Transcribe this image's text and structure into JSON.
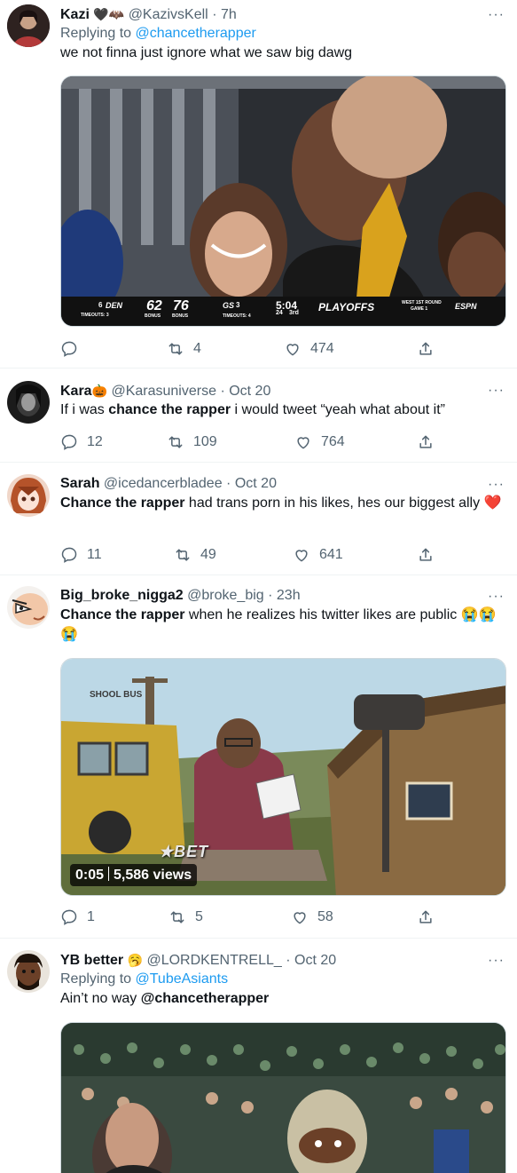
{
  "tweets": [
    {
      "name": "Kazi",
      "name_emoji": "🖤🦇",
      "handle": "@KazivsKell",
      "time": "7h",
      "replying_prefix": "Replying to",
      "replying_to": "@chancetherapper",
      "text": "we not finna just ignore what we saw big dawg",
      "scorebug": {
        "team1": "DEN",
        "seed1": "6",
        "score1": "62",
        "score2": "76",
        "team2": "GS",
        "seed2": "3",
        "timeouts1": "TIMEOUTS: 3",
        "bonus1": "BONUS",
        "bonus2": "BONUS",
        "timeouts2": "TIMEOUTS: 4",
        "clock": "5:04",
        "shot_clock": "24",
        "quarter": "3rd",
        "playoffs": "PLAYOFFS",
        "round": "WEST 1ST ROUND",
        "game": "GAME 1",
        "network": "ESPN"
      },
      "actions": {
        "reply": "",
        "retweet": "4",
        "like": "474"
      }
    },
    {
      "name": "Kara",
      "name_emoji": "🎃",
      "handle": "@Karasuniverse",
      "time": "Oct 20",
      "text_pre": "If i was ",
      "text_bold": "chance the rapper",
      "text_post": " i would tweet “yeah what about it”",
      "actions": {
        "reply": "12",
        "retweet": "109",
        "like": "764"
      }
    },
    {
      "name": "Sarah",
      "handle": "@icedancerbladee",
      "time": "Oct 20",
      "text_bold": "Chance the rapper",
      "text_post": " had trans porn in his likes, hes our biggest ally",
      "text_emoji": "❤️",
      "actions": {
        "reply": "11",
        "retweet": "49",
        "like": "641"
      }
    },
    {
      "name": "Big_broke_nigga2",
      "handle": "@broke_big",
      "time": "23h",
      "text_bold": "Chance the rapper",
      "text_post": " when he realizes his twitter likes are public",
      "text_emoji": "😭😭😭",
      "video_time": "0:05",
      "video_views": "5,586 views",
      "video_watermark": "BET",
      "actions": {
        "reply": "1",
        "retweet": "5",
        "like": "58"
      }
    },
    {
      "name": "YB better",
      "name_emoji": "🥱",
      "handle": "@LORDKENTRELL_",
      "time": "Oct 20",
      "replying_prefix": "Replying to",
      "replying_to": "@TubeAsiants",
      "text_pre": "Ain’t no way ",
      "text_bold": "@chancetherapper"
    }
  ],
  "separator": "·",
  "more_glyph": "···",
  "colors": {
    "link": "#1d9bf0",
    "muted": "#536471",
    "text": "#0f1419",
    "heart": "#e0245e"
  }
}
